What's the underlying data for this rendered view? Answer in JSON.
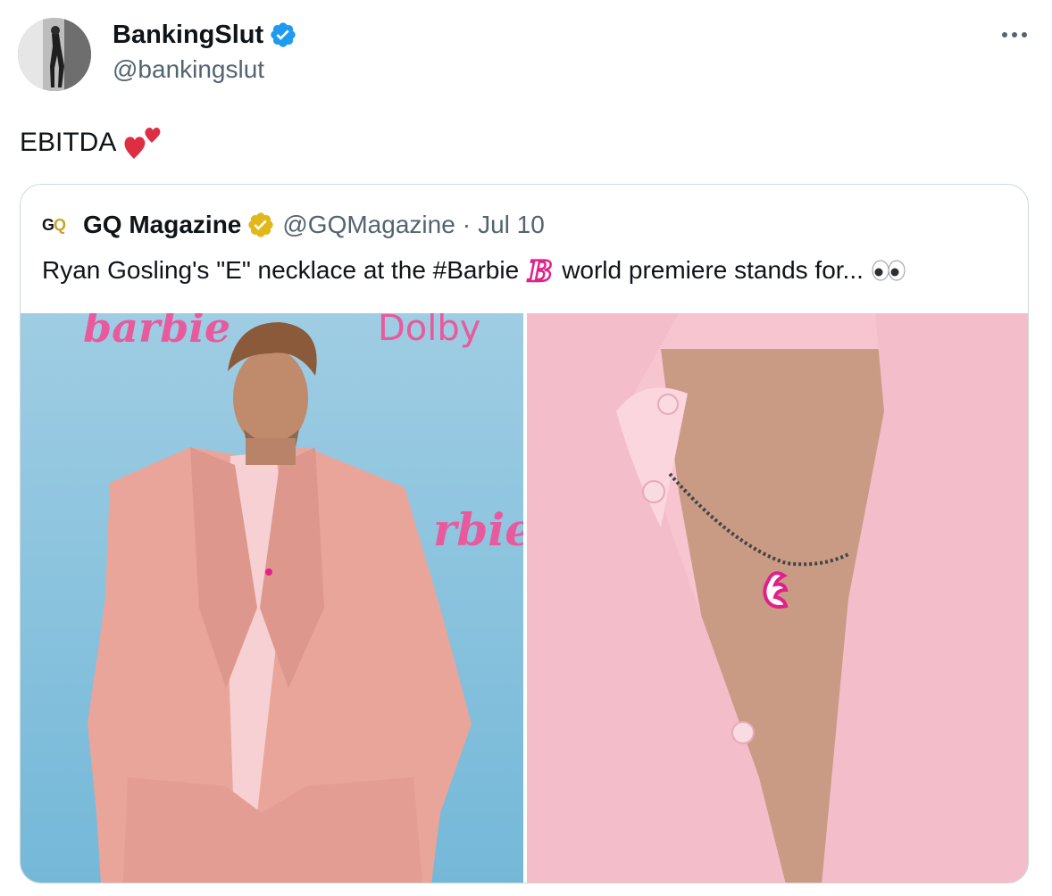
{
  "tweet": {
    "display_name": "BankingSlut",
    "handle": "@bankingslut",
    "text": "EBITDA",
    "text_emoji": "two-hearts",
    "verified_color": "#1d9bf0"
  },
  "quoted": {
    "logo": "GQ",
    "display_name": "GQ Magazine",
    "handle": "@GQMagazine",
    "separator": "·",
    "date": "Jul 10",
    "text_before": "Ryan Gosling's \"E\" necklace at the #Barbie",
    "text_emoji": "barbie-b",
    "text_after": "world premiere stands for...",
    "trailing_emoji": "eyes",
    "verified_color": "#e2b719"
  },
  "media": [
    {
      "description_icon": "photo-suit-on-blue-backdrop"
    },
    {
      "description_icon": "photo-necklace-closeup"
    }
  ],
  "colors": {
    "text_primary": "#0f1419",
    "text_secondary": "#536471",
    "border": "#cfd9de",
    "backdrop_blue": "#a9d2e6",
    "suit_pink": "#e9a59a",
    "shirt_pink": "#f5c6cf",
    "barbie_pink": "#e0218a"
  }
}
